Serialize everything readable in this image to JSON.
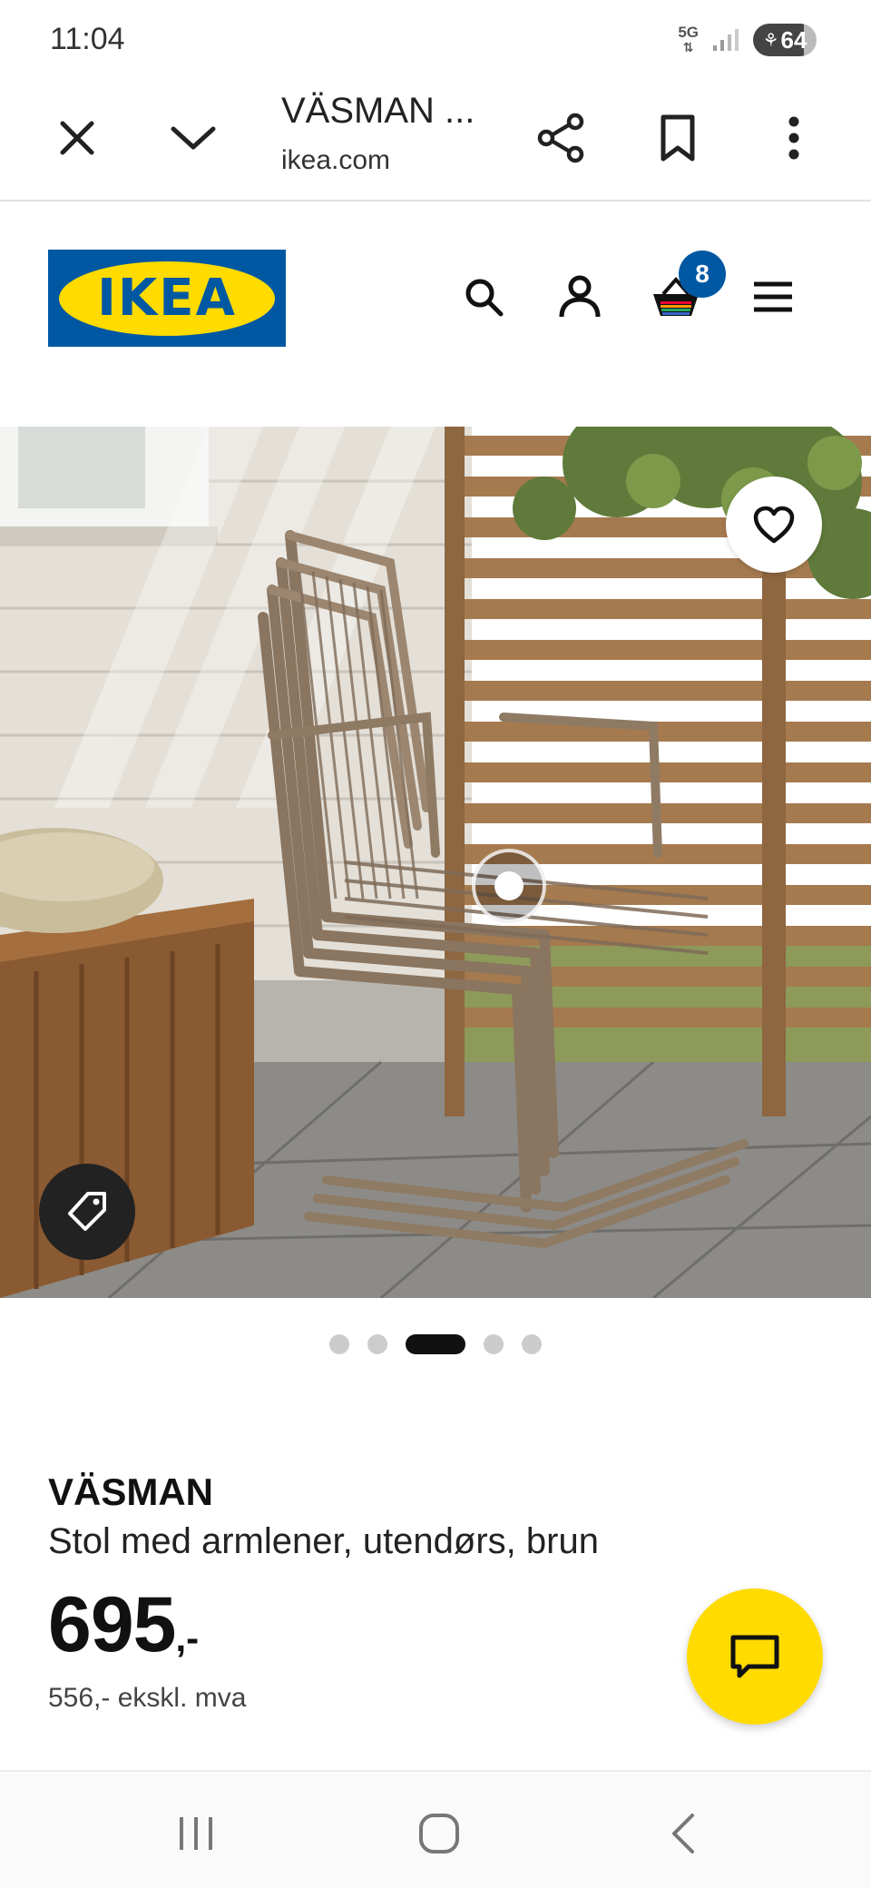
{
  "status_bar": {
    "time": "11:04",
    "network": "5G",
    "battery": "64"
  },
  "browser": {
    "page_title": "VÄSMAN ...",
    "url": "ikea.com",
    "icons": [
      "close-icon",
      "chevron-down-icon",
      "share-icon",
      "bookmark-icon",
      "more-vert-icon"
    ]
  },
  "header": {
    "logo_text": "IKEA",
    "cart_count": "8",
    "brand_colors": {
      "blue": "#0058a3",
      "yellow": "#ffdb00"
    },
    "icons": [
      "search-icon",
      "user-icon",
      "basket-icon",
      "menu-icon"
    ]
  },
  "gallery": {
    "total_images": 5,
    "active_index": 2,
    "icons": [
      "heart-icon",
      "tag-icon",
      "hotspot-dot-icon"
    ]
  },
  "product": {
    "name": "VÄSMAN",
    "description": "Stol med armlener, utendørs, brun",
    "price_integer": "695",
    "price_suffix": ",-",
    "price_ex_vat": "556,- ekskl. mva"
  },
  "chat": {
    "icon": "chat-icon",
    "color": "#ffdb00"
  },
  "nav_bar": {
    "icons": [
      "recent-apps-icon",
      "home-icon",
      "back-icon"
    ]
  }
}
